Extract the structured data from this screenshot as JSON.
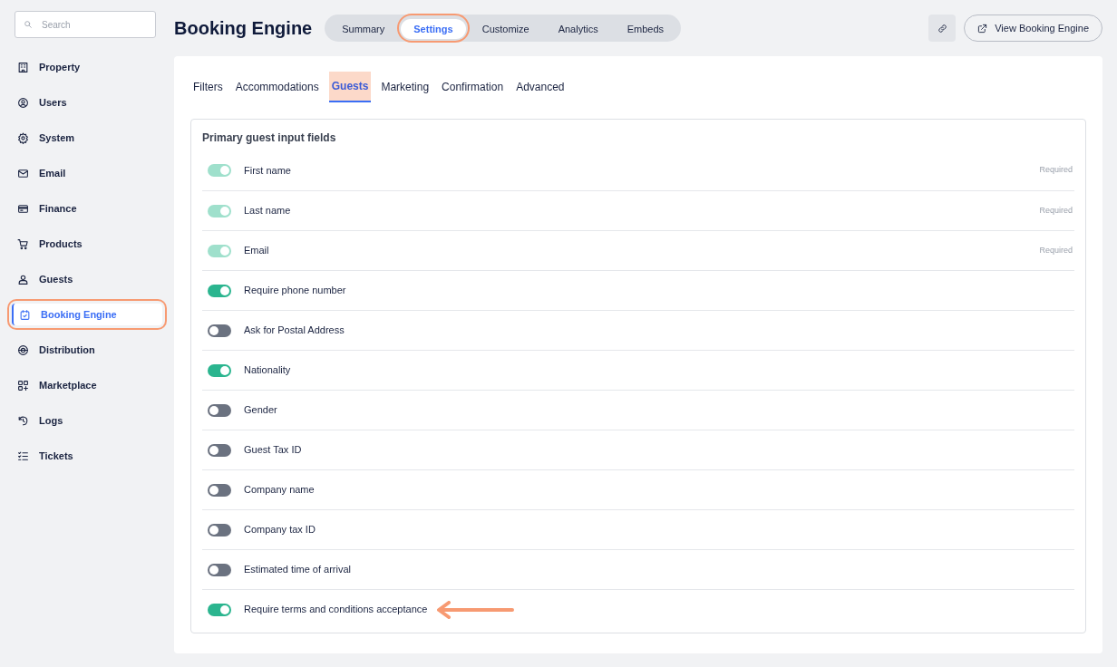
{
  "sidebar": {
    "search": {
      "placeholder": "Search"
    },
    "items": [
      {
        "label": "Property",
        "selected": false,
        "highlighted": false
      },
      {
        "label": "Users",
        "selected": false,
        "highlighted": false
      },
      {
        "label": "System",
        "selected": false,
        "highlighted": false
      },
      {
        "label": "Email",
        "selected": false,
        "highlighted": false
      },
      {
        "label": "Finance",
        "selected": false,
        "highlighted": false
      },
      {
        "label": "Products",
        "selected": false,
        "highlighted": false
      },
      {
        "label": "Guests",
        "selected": false,
        "highlighted": false
      },
      {
        "label": "Booking Engine",
        "selected": true,
        "highlighted": true
      },
      {
        "label": "Distribution",
        "selected": false,
        "highlighted": false
      },
      {
        "label": "Marketplace",
        "selected": false,
        "highlighted": false
      },
      {
        "label": "Logs",
        "selected": false,
        "highlighted": false
      },
      {
        "label": "Tickets",
        "selected": false,
        "highlighted": false
      }
    ]
  },
  "header": {
    "title": "Booking Engine",
    "tabs": [
      {
        "label": "Summary",
        "selected": false,
        "highlighted": false
      },
      {
        "label": "Settings",
        "selected": true,
        "highlighted": true
      },
      {
        "label": "Customize",
        "selected": false,
        "highlighted": false
      },
      {
        "label": "Analytics",
        "selected": false,
        "highlighted": false
      },
      {
        "label": "Embeds",
        "selected": false,
        "highlighted": false
      }
    ],
    "view_button": "View Booking Engine"
  },
  "subtabs": [
    {
      "label": "Filters",
      "selected": false
    },
    {
      "label": "Accommodations",
      "selected": false
    },
    {
      "label": "Guests",
      "selected": true
    },
    {
      "label": "Marketing",
      "selected": false
    },
    {
      "label": "Confirmation",
      "selected": false
    },
    {
      "label": "Advanced",
      "selected": false
    }
  ],
  "section": {
    "title": "Primary guest input fields",
    "fields": [
      {
        "label": "First name",
        "on": true,
        "disabled": true,
        "note": "Required",
        "pointed": false
      },
      {
        "label": "Last name",
        "on": true,
        "disabled": true,
        "note": "Required",
        "pointed": false
      },
      {
        "label": "Email",
        "on": true,
        "disabled": true,
        "note": "Required",
        "pointed": false
      },
      {
        "label": "Require phone number",
        "on": true,
        "disabled": false,
        "pointed": false
      },
      {
        "label": "Ask for Postal Address",
        "on": false,
        "disabled": false,
        "pointed": false
      },
      {
        "label": "Nationality",
        "on": true,
        "disabled": false,
        "pointed": false
      },
      {
        "label": "Gender",
        "on": false,
        "disabled": false,
        "pointed": false
      },
      {
        "label": "Guest Tax ID",
        "on": false,
        "disabled": false,
        "pointed": false
      },
      {
        "label": "Company name",
        "on": false,
        "disabled": false,
        "pointed": false
      },
      {
        "label": "Company tax ID",
        "on": false,
        "disabled": false,
        "pointed": false
      },
      {
        "label": "Estimated time of arrival",
        "on": false,
        "disabled": false,
        "pointed": false
      },
      {
        "label": "Require terms and conditions acceptance",
        "on": true,
        "disabled": false,
        "pointed": true
      }
    ]
  }
}
